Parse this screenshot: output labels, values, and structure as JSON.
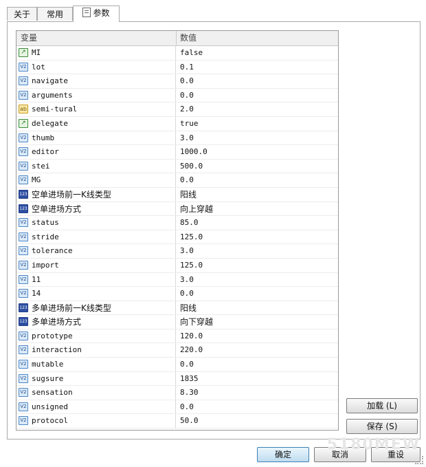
{
  "tabs": [
    {
      "label": "关于"
    },
    {
      "label": "常用"
    },
    {
      "label": "参数"
    }
  ],
  "table": {
    "col_name": "变量",
    "col_value": "数值",
    "rows": [
      {
        "icon": "line",
        "name": "MI",
        "value": "false"
      },
      {
        "icon": "num",
        "name": "lot",
        "value": "0.1"
      },
      {
        "icon": "num",
        "name": "navigate",
        "value": "0.0"
      },
      {
        "icon": "num",
        "name": "arguments",
        "value": "0.0"
      },
      {
        "icon": "str",
        "name": "semi-tural",
        "value": "2.0"
      },
      {
        "icon": "line",
        "name": "delegate",
        "value": "true"
      },
      {
        "icon": "num",
        "name": "thumb",
        "value": "3.0"
      },
      {
        "icon": "num",
        "name": "editor",
        "value": "1000.0"
      },
      {
        "icon": "num",
        "name": "stei",
        "value": "500.0"
      },
      {
        "icon": "num",
        "name": "MG",
        "value": "0.0"
      },
      {
        "icon": "enum",
        "name": "空单进场前一K线类型",
        "value": "阳线"
      },
      {
        "icon": "enum",
        "name": "空单进场方式",
        "value": "向上穿越"
      },
      {
        "icon": "num",
        "name": "status",
        "value": "85.0"
      },
      {
        "icon": "num",
        "name": "stride",
        "value": "125.0"
      },
      {
        "icon": "num",
        "name": "tolerance",
        "value": "3.0"
      },
      {
        "icon": "num",
        "name": "import",
        "value": "125.0"
      },
      {
        "icon": "num",
        "name": "11",
        "value": "3.0"
      },
      {
        "icon": "num",
        "name": "14",
        "value": "0.0"
      },
      {
        "icon": "enum",
        "name": "多单进场前一K线类型",
        "value": "阳线"
      },
      {
        "icon": "enum",
        "name": "多单进场方式",
        "value": "向下穿越"
      },
      {
        "icon": "num",
        "name": "prototype",
        "value": "120.0"
      },
      {
        "icon": "num",
        "name": "interaction",
        "value": "220.0"
      },
      {
        "icon": "num",
        "name": "mutable",
        "value": "0.0"
      },
      {
        "icon": "num",
        "name": "sugsure",
        "value": "1835"
      },
      {
        "icon": "num",
        "name": "sensation",
        "value": "8.30"
      },
      {
        "icon": "num",
        "name": "unsigned",
        "value": "0.0"
      },
      {
        "icon": "num",
        "name": "protocol",
        "value": "50.0"
      }
    ]
  },
  "icon_text": {
    "num": "V2",
    "line": "↗",
    "str": "ab",
    "enum": "123"
  },
  "side_buttons": {
    "load": "加载 (L)",
    "save": "保存 (S)"
  },
  "footer_buttons": {
    "ok": "确定",
    "cancel": "取消",
    "reset": "重设"
  },
  "watermark": "5180MEW"
}
